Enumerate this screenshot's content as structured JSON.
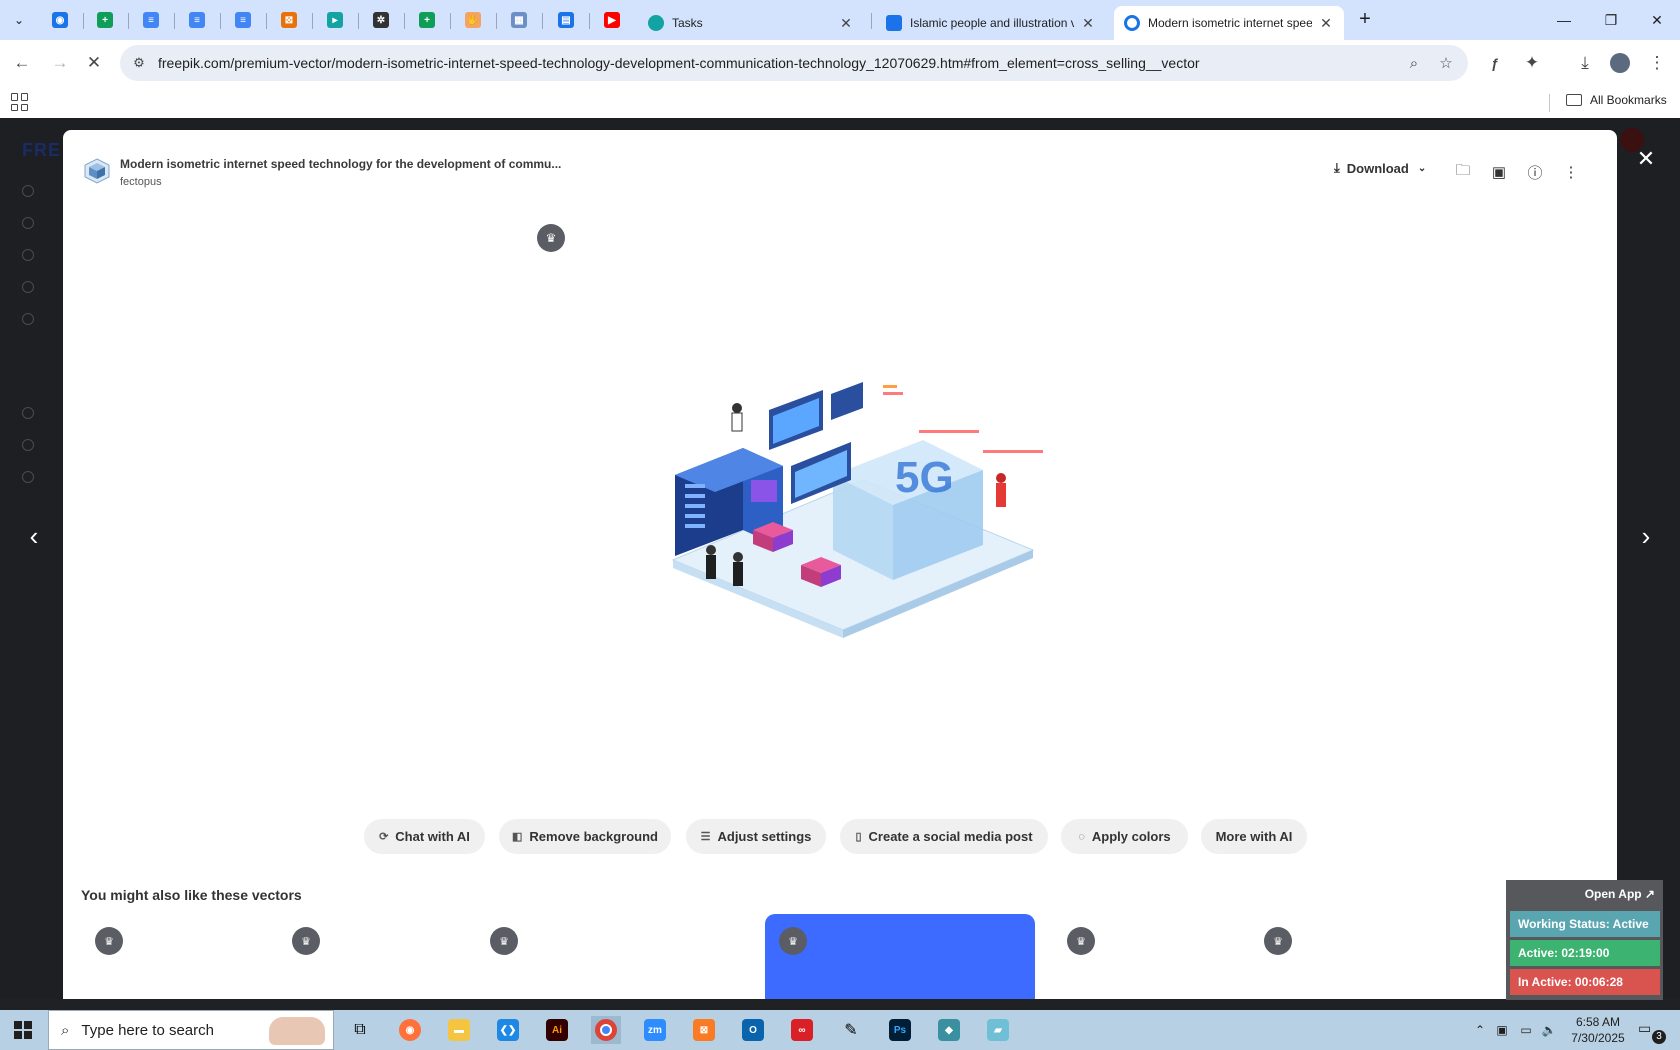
{
  "browser": {
    "pinned_tabs": [
      {
        "name": "tab-pinned-1",
        "icon": "globe-icon",
        "color": "#1a73e8",
        "glyph": "◉"
      },
      {
        "name": "tab-pinned-2",
        "icon": "sheets-icon",
        "color": "#0f9d58",
        "glyph": "+"
      },
      {
        "name": "tab-pinned-3",
        "icon": "docs-icon",
        "color": "#4285f4",
        "glyph": "≡"
      },
      {
        "name": "tab-pinned-4",
        "icon": "docs-icon",
        "color": "#4285f4",
        "glyph": "≡"
      },
      {
        "name": "tab-pinned-5",
        "icon": "docs-icon",
        "color": "#4285f4",
        "glyph": "≡"
      },
      {
        "name": "tab-pinned-6",
        "icon": "app-icon",
        "color": "#e8710a",
        "glyph": "⊠"
      },
      {
        "name": "tab-pinned-7",
        "icon": "clickup-icon",
        "color": "#14a3a3",
        "glyph": "▸"
      },
      {
        "name": "tab-pinned-8",
        "icon": "chatgpt-icon",
        "color": "#333333",
        "glyph": "✲"
      },
      {
        "name": "tab-pinned-9",
        "icon": "sheets-icon",
        "color": "#0f9d58",
        "glyph": "+"
      },
      {
        "name": "tab-pinned-10",
        "icon": "hand-icon",
        "color": "#f4a460",
        "glyph": "✋"
      },
      {
        "name": "tab-pinned-11",
        "icon": "grid-icon",
        "color": "#6b8fc7",
        "glyph": "▦"
      },
      {
        "name": "tab-pinned-12",
        "icon": "forms-icon",
        "color": "#1a73e8",
        "glyph": "▤"
      },
      {
        "name": "tab-pinned-13",
        "icon": "youtube-icon",
        "color": "#ff0000",
        "glyph": "▶"
      }
    ],
    "tabs": [
      {
        "title": "Tasks",
        "fav_color": "#14a3a3"
      },
      {
        "title": "Islamic people and illustration v",
        "fav_color": "#1a73e8"
      },
      {
        "title": "Modern isometric internet spee",
        "fav_color": "#1a73e8"
      }
    ],
    "url": "freepik.com/premium-vector/modern-isometric-internet-speed-technology-development-communication-technology_12070629.htm#from_element=cross_selling__vector",
    "all_bookmarks": "All Bookmarks"
  },
  "modal": {
    "title": "Modern isometric internet speed technology for the development of commu...",
    "author": "fectopus",
    "download_label": "Download",
    "ai_tools": [
      {
        "label": "Chat with AI",
        "icon": "chat-ai-icon",
        "glyph": "⟳"
      },
      {
        "label": "Remove background",
        "icon": "remove-background-icon",
        "glyph": "◧"
      },
      {
        "label": "Adjust settings",
        "icon": "sliders-icon",
        "glyph": "☰"
      },
      {
        "label": "Create a social media post",
        "icon": "phone-icon",
        "glyph": "▯"
      },
      {
        "label": "Apply colors",
        "icon": "palette-icon",
        "glyph": "◌"
      },
      {
        "label": "More with AI",
        "icon": "",
        "glyph": ""
      }
    ],
    "related_title": "You might also like these vectors"
  },
  "widget": {
    "open_app": "Open App ↗",
    "working_status": "Working Status: Active",
    "active": "Active: 02:19:00",
    "inactive": "In Active: 00:06:28",
    "colors": {
      "status": "#5aa6b0",
      "active": "#3cb371",
      "inactive": "#d9534f"
    }
  },
  "taskbar": {
    "search_placeholder": "Type here to search",
    "time": "6:58 AM",
    "date": "7/30/2025",
    "notification_count": "3"
  }
}
